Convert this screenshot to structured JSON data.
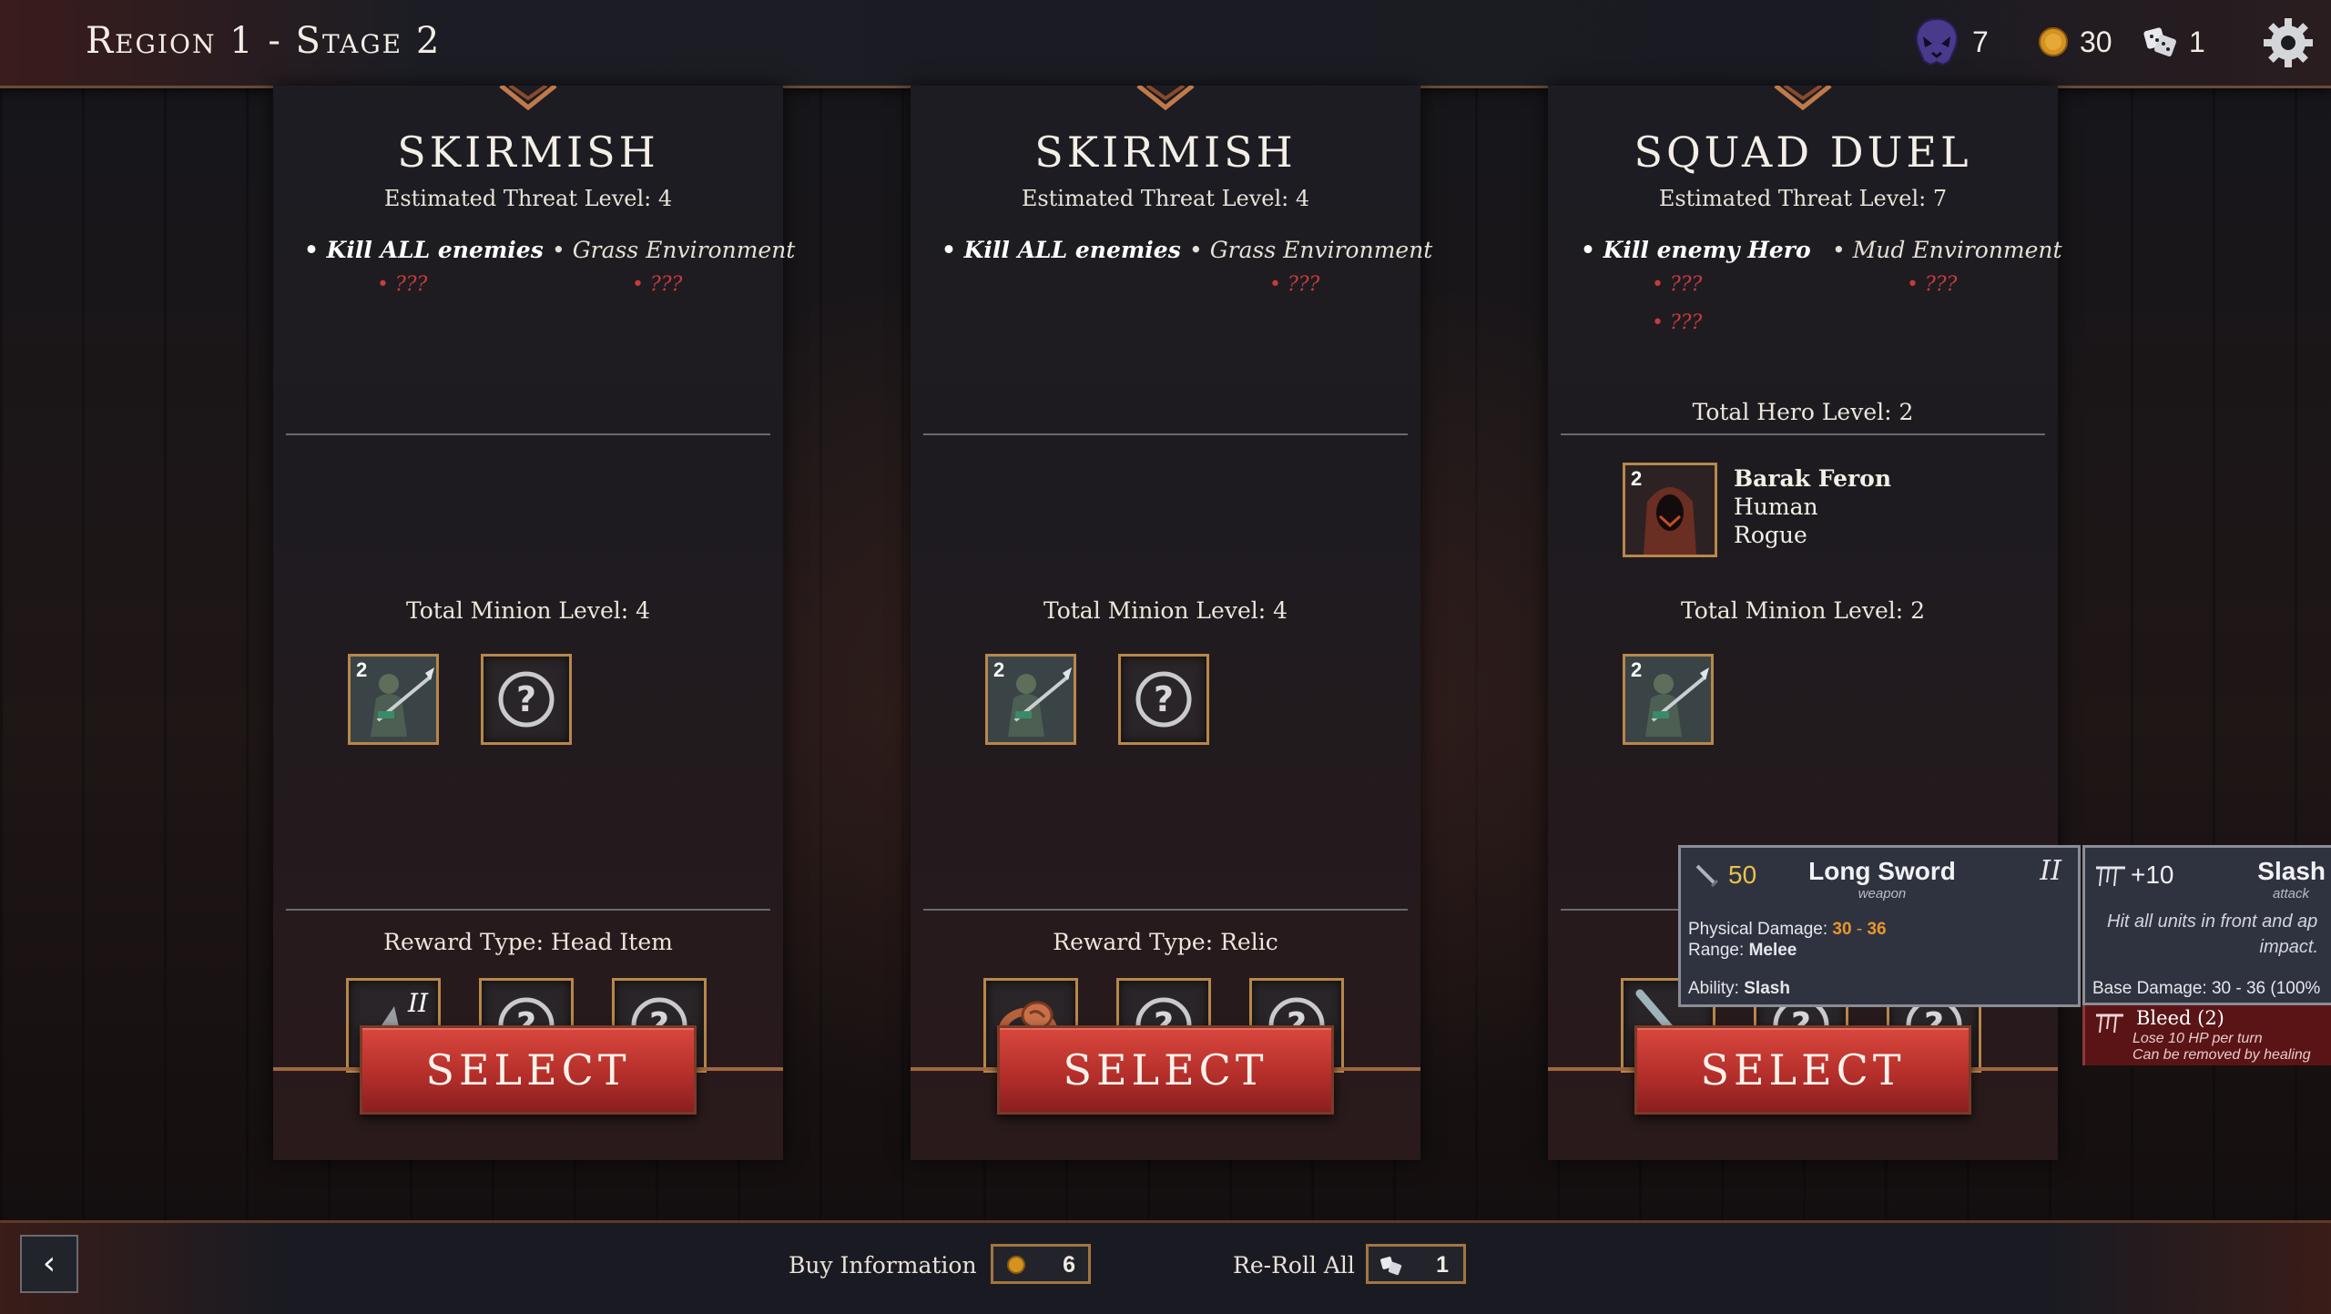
{
  "header": {
    "stage_title": "Region 1 - Stage 2",
    "resources": {
      "skulls": "7",
      "gold": "30",
      "rerolls": "1"
    }
  },
  "cards": [
    {
      "title": "SKIRMISH",
      "threat": "Estimated Threat Level: 4",
      "objective": "• Kill ALL enemies",
      "environment": "• Grass Environment",
      "hidden_a": "• ???",
      "hidden_b": "• ???",
      "minion_label": "Total Minion Level: 4",
      "minion_level": "2",
      "reward_label": "Reward Type: Head Item",
      "reward_tier": "II",
      "select_label": "SELECT"
    },
    {
      "title": "SKIRMISH",
      "threat": "Estimated Threat Level: 4",
      "objective": "• Kill ALL enemies",
      "environment": "• Grass Environment",
      "hidden_b": "• ???",
      "minion_label": "Total Minion Level: 4",
      "minion_level": "2",
      "reward_label": "Reward Type: Relic",
      "select_label": "SELECT"
    },
    {
      "title": "SQUAD DUEL",
      "threat": "Estimated Threat Level: 7",
      "objective": "• Kill enemy Hero",
      "environment": "• Mud Environment",
      "hidden_a": "• ???",
      "hidden_c": "• ???",
      "hidden_b": "• ???",
      "hero_label": "Total Hero Level: 2",
      "hero": {
        "level": "2",
        "name": "Barak Feron",
        "race": "Human",
        "class": "Rogue"
      },
      "minion_label": "Total Minion Level: 2",
      "minion_level": "2",
      "select_label": "SELECT"
    }
  ],
  "tooltip": {
    "weapon": {
      "price": "50",
      "name": "Long Sword",
      "type": "weapon",
      "tier": "II",
      "phys_label": "Physical Damage:",
      "phys_min": "30",
      "phys_sep": " - ",
      "phys_max": "36",
      "range_label": "Range:",
      "range": "Melee",
      "ability_label": "Ability:",
      "ability": "Slash"
    },
    "ability": {
      "bonus": "+10",
      "name": "Slash",
      "type": "attack",
      "desc1": "Hit all units in front and ap",
      "desc2": "impact.",
      "base_damage": "Base Damage: 30 - 36 (100%"
    },
    "status": {
      "name": "Bleed (2)",
      "line1": "Lose 10 HP per turn",
      "line2": "Can be removed by healing"
    }
  },
  "footer": {
    "buy_info_label": "Buy Information",
    "buy_info_cost": "6",
    "reroll_label": "Re-Roll All",
    "reroll_cost": "1",
    "back_glyph": "‹"
  }
}
